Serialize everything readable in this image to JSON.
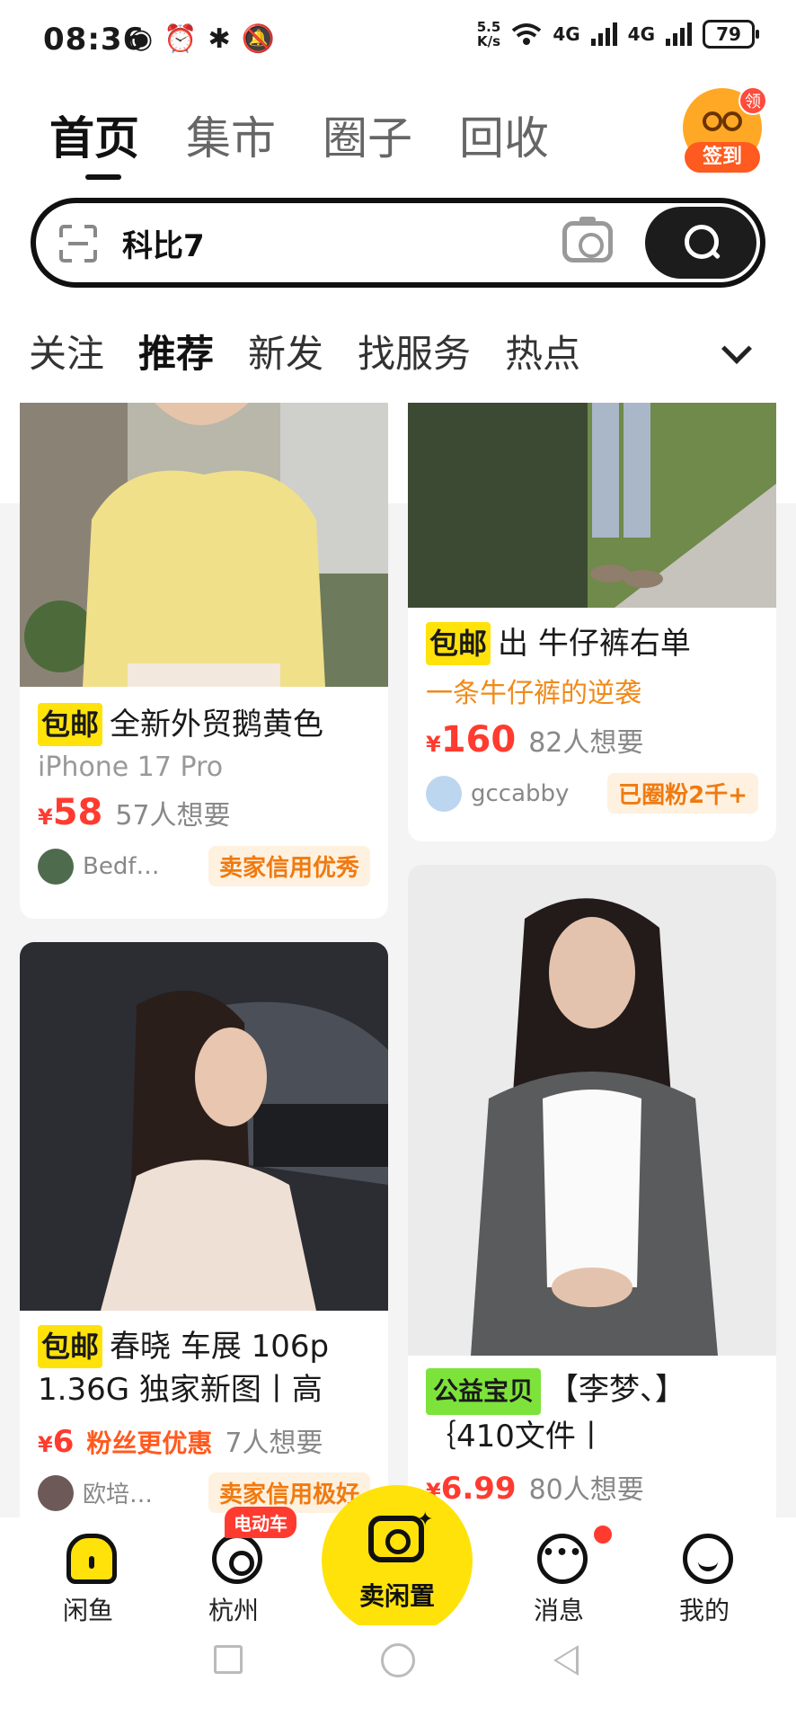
{
  "status": {
    "time": "08:36",
    "speed_top": "5.5",
    "speed_bottom": "K/s",
    "net1": "4G",
    "net2": "4G",
    "battery": "79"
  },
  "header": {
    "nav": [
      "首页",
      "集市",
      "圈子",
      "回收"
    ],
    "signin": {
      "badge": "领",
      "label": "签到"
    },
    "search": {
      "query": "科比7"
    },
    "subtabs": [
      "关注",
      "推荐",
      "新发",
      "找服务",
      "热点"
    ]
  },
  "feed": [
    {
      "tag": "包邮",
      "title": "全新外贸鹅黄色",
      "sub": "iPhone 17 Pro",
      "currency": "¥",
      "price": "58",
      "want": "57人想要",
      "seller": "Bedf…",
      "badge": "卖家信用优秀"
    },
    {
      "tag": "包邮",
      "title": "出 牛仔裤右单",
      "sub": "一条牛仔裤的逆袭",
      "currency": "¥",
      "price": "160",
      "want": "82人想要",
      "seller": "gccabby",
      "badge": "已圈粉2千+"
    },
    {
      "tag": "包邮",
      "title": "春晓 车展 106p 1.36G 独家新图丨高",
      "currency": "¥",
      "price": "6",
      "fan": "粉丝更优惠",
      "want": "7人想要",
      "seller": "欧培…",
      "badge": "卖家信用极好"
    },
    {
      "tag": "公益宝贝",
      "title": "【李梦、】｛410文件丨",
      "currency": "¥",
      "price": "6.99",
      "want": "80人想要"
    }
  ],
  "tabbar": {
    "home": "闲鱼",
    "city": "杭州",
    "city_badge": "电动车",
    "sell": "卖闲置",
    "msg": "消息",
    "me": "我的"
  },
  "colors": {
    "accent": "#ffe20a",
    "price": "#ff3b2f",
    "sub": "#f08a1a"
  }
}
